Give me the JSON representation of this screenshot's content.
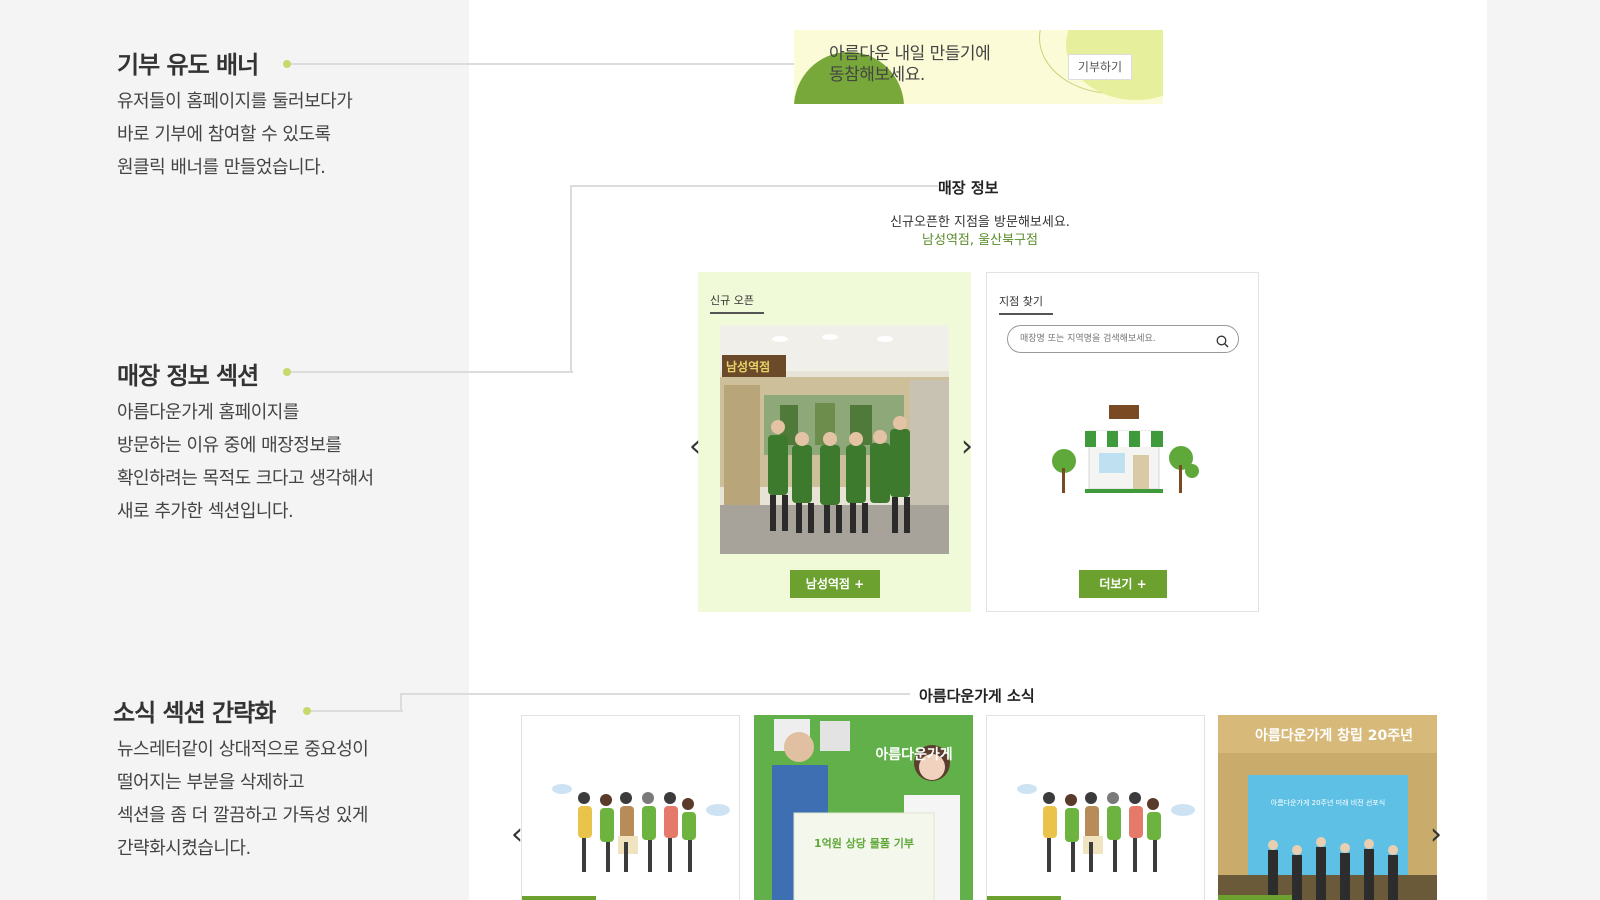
{
  "notes": [
    {
      "title": "기부 유도 배너",
      "lines": [
        "유저들이 홈페이지를 둘러보다가",
        "바로 기부에 참여할 수 있도록",
        "원클릭 배너를 만들었습니다."
      ]
    },
    {
      "title": "매장 정보 섹션",
      "lines": [
        "아름다운가게 홈페이지를",
        "방문하는 이유 중에 매장정보를",
        "확인하려는 목적도 크다고 생각해서",
        "새로 추가한 섹션입니다."
      ]
    },
    {
      "title": "소식 섹션 간략화",
      "lines": [
        "뉴스레터같이 상대적으로 중요성이",
        "떨어지는 부분을 삭제하고",
        "섹션을 좀 더 깔끔하고 가독성 있게",
        "간략화시켰습니다."
      ]
    }
  ],
  "banner": {
    "line1": "아름다운 내일 만들기에",
    "line2": "동참해보세요.",
    "button": "기부하기"
  },
  "store": {
    "title": "매장 정보",
    "subtitle": "신규오픈한 지점을 방문해보세요.",
    "highlight": "남성역점, 울산북구점",
    "new_tab": "신규 오픈",
    "new_sign": "남성역점",
    "new_button": "남성역점 +",
    "find_tab": "지점 찾기",
    "search_placeholder": "매장명 또는 지역명을 검색해보세요.",
    "more_button": "더보기 +"
  },
  "news": {
    "title": "아름다운가게 소식",
    "card2_heading": "아름다운가게",
    "card2_caption": "1억원 상당 물품 기부",
    "card4_heading": "아름다운가게 창립 20주년",
    "card4_screen": "아름다운가게 20주년 미래 비전 선포식"
  },
  "colors": {
    "accent": "#6ca12f",
    "banner_bg": "#fcfbd7",
    "card_bg": "#f1fad8",
    "highlight_text": "#5a8c2a"
  }
}
